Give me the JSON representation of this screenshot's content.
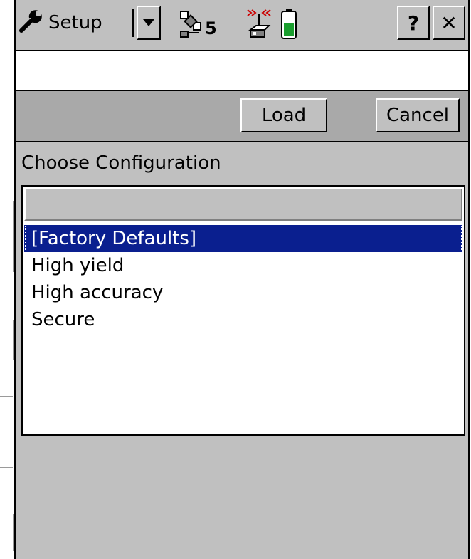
{
  "title_bar": {
    "menu_label": "Setup",
    "menu_icon": "wrench-icon",
    "dropdown_icon": "chevron-down-icon",
    "satellite_icon": "satellite-icon",
    "satellite_count": "5",
    "radio_icon": "radio-signal-icon",
    "battery_icon": "battery-icon",
    "help_label": "?",
    "close_label": "✕"
  },
  "toolbar": {
    "load_label": "Load",
    "cancel_label": "Cancel"
  },
  "main": {
    "choose_label": "Choose Configuration",
    "configurations": [
      {
        "label": "[Factory Defaults]",
        "selected": true
      },
      {
        "label": "High yield",
        "selected": false
      },
      {
        "label": "High accuracy",
        "selected": false
      },
      {
        "label": "Secure",
        "selected": false
      }
    ]
  },
  "colors": {
    "selection": "#0a1f8f",
    "chrome": "#c0c0c0",
    "toolbar": "#a9a9a9",
    "battery_level": "#1a9e2e",
    "radio_signal": "#cc0000"
  }
}
